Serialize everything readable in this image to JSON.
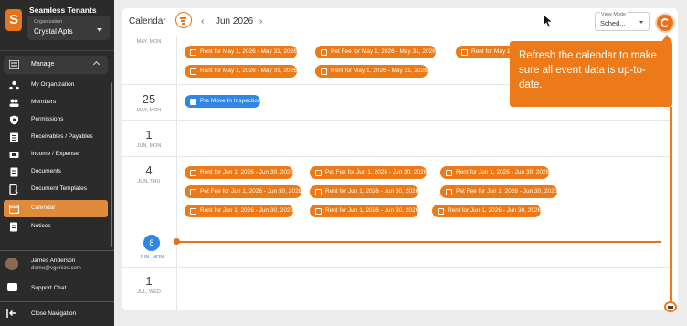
{
  "sidebar": {
    "logo": "S",
    "brand": "Seamless Tenants",
    "org_label": "Organization",
    "org_name": "Crystal Apts",
    "section": "Manage",
    "items": [
      {
        "label": "My Organization",
        "icon": "org-icon"
      },
      {
        "label": "Members",
        "icon": "members-icon"
      },
      {
        "label": "Permissions",
        "icon": "shield-icon"
      },
      {
        "label": "Receivables / Payables",
        "icon": "ledger-icon"
      },
      {
        "label": "Income / Expense",
        "icon": "money-icon"
      },
      {
        "label": "Documents",
        "icon": "document-icon"
      },
      {
        "label": "Document Templates",
        "icon": "template-icon"
      },
      {
        "label": "Calendar",
        "icon": "calendar-icon",
        "active": true
      },
      {
        "label": "Notices",
        "icon": "notice-icon"
      }
    ],
    "user": {
      "name": "James Anderson",
      "email": "demo@vgenize.com"
    },
    "support": "Support Chat",
    "close_nav": "Close Navigation"
  },
  "calendar": {
    "title": "Calendar",
    "month": "Jun 2026",
    "view_mode_label": "View Mode",
    "view_mode_value": "Sched...",
    "days": [
      {
        "day": "25",
        "dow": "MAY, MON"
      },
      {
        "day": "1",
        "dow": "JUN, MON"
      },
      {
        "day": "4",
        "dow": "JUN, THU"
      },
      {
        "day": "8",
        "dow": "JUN, MON"
      },
      {
        "day": "1",
        "dow": "JUL, WED"
      }
    ],
    "partial_dow": "MAY, MON",
    "may_events": [
      "Rent for May 1, 2026 - May 31, 2026",
      "Pet Fee for May 1, 2026 - May 31, 2026",
      "Rent for May 1, 2026 - May 31, 2026",
      "Rent for May 1, 2026 - May 31, 2026",
      "Rent for May 1, 2026 - May 31, 2026"
    ],
    "inspection_event": "Pre Move In Inspection",
    "jun_events": [
      "Rent for Jun 1, 2026 - Jun 30, 2026",
      "Pet Fee for Jun 1, 2026 - Jun 30, 2026",
      "Rent for Jun 1, 2026 - Jun 30, 2026",
      "Pet Fee for Jun 1, 2026 - Jun 30, 2026",
      "Rent for Jun 1, 2026 - Jun 30, 2026",
      "Pet Fee for Jun 1, 2026 - Jun 30, 2026",
      "Rent for Jun 1, 2026 - Jun 30, 2026",
      "Rent for Jun 1, 2026 - Jun 30, 2026",
      "Rent for Jun 1, 2026 - Jun 30, 2026"
    ]
  },
  "tooltip": {
    "text": "Refresh the calendar to make sure all event data is up-to-date."
  },
  "colors": {
    "accent": "#ec7a18",
    "today": "#2f86e4",
    "sidebar": "#2b2b2b"
  }
}
